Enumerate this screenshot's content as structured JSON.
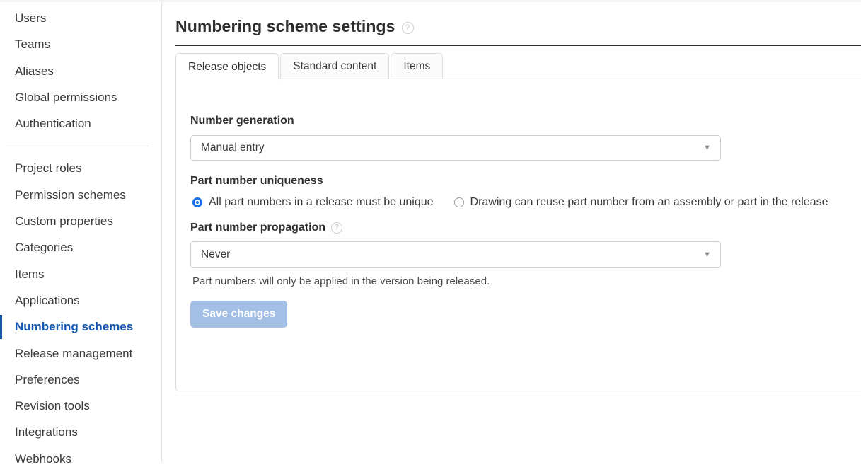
{
  "sidebar": {
    "group1": [
      {
        "label": "Users",
        "active": false
      },
      {
        "label": "Teams",
        "active": false
      },
      {
        "label": "Aliases",
        "active": false
      },
      {
        "label": "Global permissions",
        "active": false
      },
      {
        "label": "Authentication",
        "active": false
      }
    ],
    "group2": [
      {
        "label": "Project roles",
        "active": false
      },
      {
        "label": "Permission schemes",
        "active": false
      },
      {
        "label": "Custom properties",
        "active": false
      },
      {
        "label": "Categories",
        "active": false
      },
      {
        "label": "Items",
        "active": false
      },
      {
        "label": "Applications",
        "active": false
      },
      {
        "label": "Numbering schemes",
        "active": true
      },
      {
        "label": "Release management",
        "active": false
      },
      {
        "label": "Preferences",
        "active": false
      },
      {
        "label": "Revision tools",
        "active": false
      },
      {
        "label": "Integrations",
        "active": false
      },
      {
        "label": "Webhooks",
        "active": false
      }
    ]
  },
  "header": {
    "title": "Numbering scheme settings",
    "help_icon": "question-circle-icon",
    "help_glyph": "?"
  },
  "tabs": [
    {
      "label": "Release objects",
      "active": true
    },
    {
      "label": "Standard content",
      "active": false
    },
    {
      "label": "Items",
      "active": false
    }
  ],
  "form": {
    "number_generation": {
      "label": "Number generation",
      "value": "Manual entry",
      "caret_icon": "chevron-down-icon",
      "caret_glyph": "▼"
    },
    "part_number_uniqueness": {
      "label": "Part number uniqueness",
      "options": [
        {
          "label": "All part numbers in a release must be unique",
          "selected": true
        },
        {
          "label": "Drawing can reuse part number from an assembly or part in the release",
          "selected": false
        }
      ]
    },
    "part_number_propagation": {
      "label": "Part number propagation",
      "help_icon": "question-circle-icon",
      "help_glyph": "?",
      "value": "Never",
      "caret_icon": "chevron-down-icon",
      "caret_glyph": "▼",
      "hint": "Part numbers will only be applied in the version being released."
    },
    "save_button": {
      "label": "Save changes",
      "color": "#a3bfe6",
      "text_color": "#ffffff",
      "disabled": true
    }
  },
  "colors": {
    "accent": "#1557b0",
    "radio_selected": "#1a73e8",
    "border": "#dcdcdc",
    "text": "#3a3a3a"
  }
}
